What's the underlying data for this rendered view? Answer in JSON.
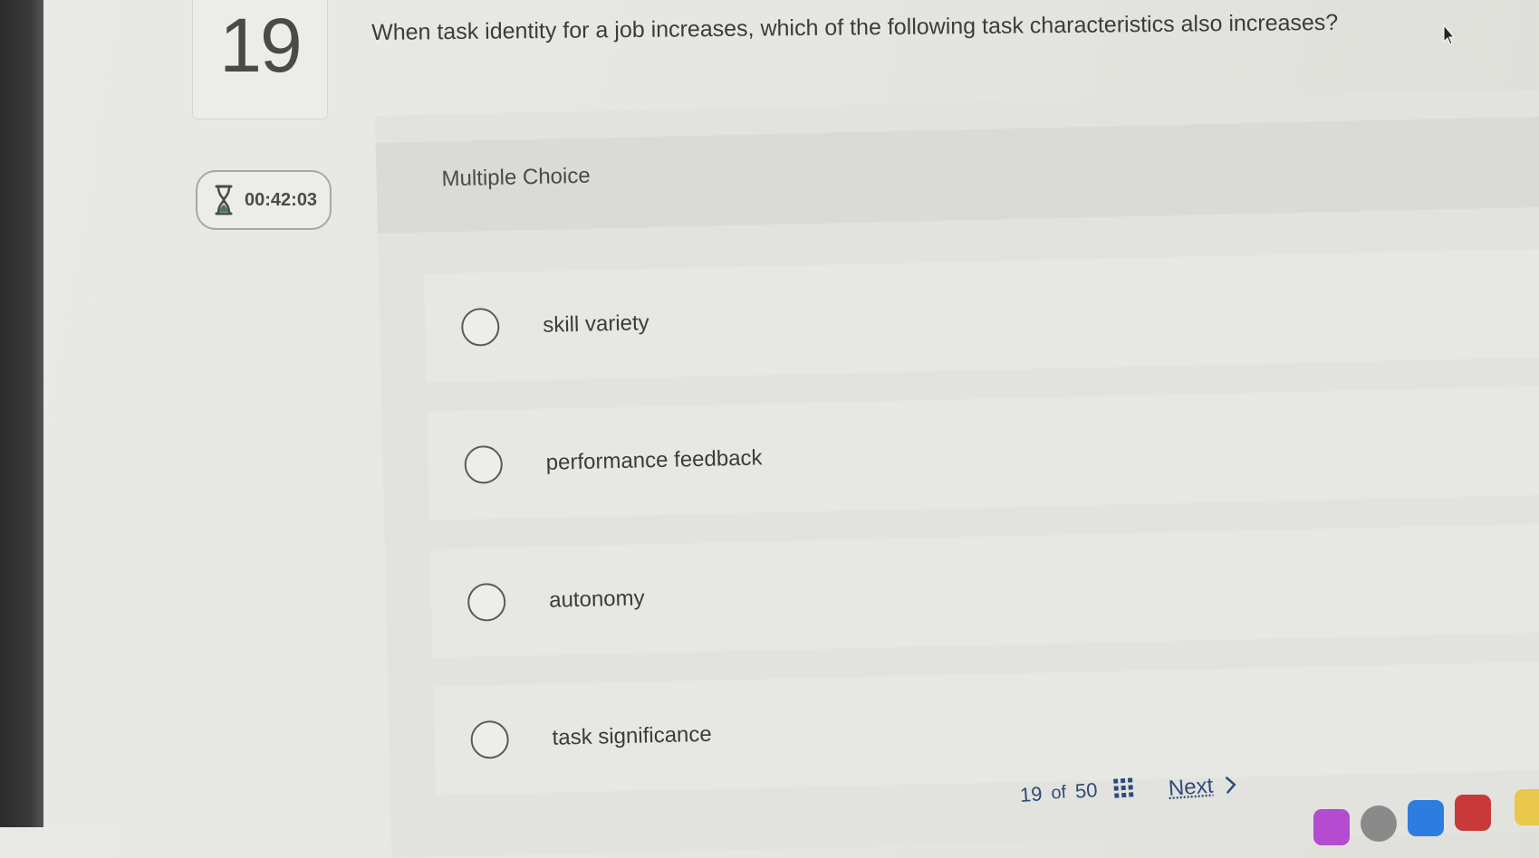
{
  "question": {
    "number": "19",
    "text": "When task identity for a job increases, which of the following task characteristics also increases?"
  },
  "timer": {
    "icon": "hourglass-icon",
    "time": "00:42:03"
  },
  "question_type": "Multiple Choice",
  "options": [
    {
      "label": "skill variety",
      "selected": false
    },
    {
      "label": "performance feedback",
      "selected": false
    },
    {
      "label": "autonomy",
      "selected": false
    },
    {
      "label": "task significance",
      "selected": false
    }
  ],
  "pagination": {
    "current": "19",
    "of_label": "of",
    "total": "50",
    "grid_icon": "grid-icon"
  },
  "navigation": {
    "next_label": "Next",
    "next_icon": "chevron-right-icon"
  },
  "colors": {
    "link": "#2f4a7a",
    "timer_icon": "#4a7a52",
    "dock_red": "#c83a3a",
    "dock_blue": "#2d7ce0",
    "dock_purple": "#b44bd0",
    "dock_yellow": "#e8c74a"
  }
}
